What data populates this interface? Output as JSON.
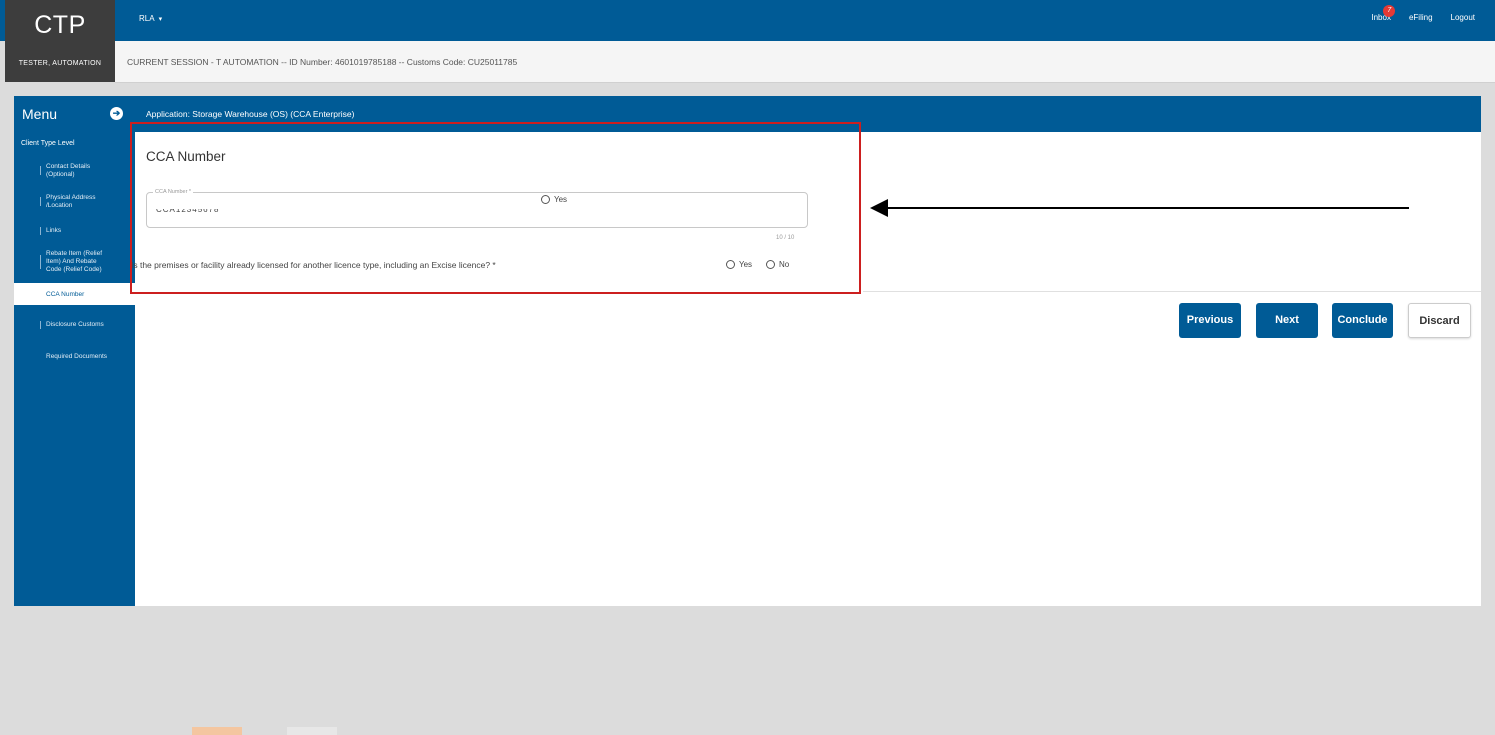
{
  "app": {
    "logo": "CTP",
    "user": "TESTER, AUTOMATION",
    "language": "RLA",
    "top_links": {
      "inbox": "Inbox",
      "inbox_count": "7",
      "efiling": "eFiling",
      "logout": "Logout"
    }
  },
  "session": {
    "text": "CURRENT SESSION - T AUTOMATION -- ID Number: 4601019785188 -- Customs Code: CU25011785"
  },
  "sidebar": {
    "title": "Menu",
    "section": "Client Type Level",
    "items": [
      {
        "label_lines": [
          "Contact Details",
          "(Optional)"
        ]
      },
      {
        "label_lines": [
          "Physical Address",
          "/Location"
        ]
      },
      {
        "label_lines": [
          "Links"
        ]
      },
      {
        "label_lines": [
          "Rebate Item (Relief",
          "Item) And Rebate",
          "Code (Relief Code)"
        ]
      },
      {
        "label_lines": [
          "CCA Number"
        ]
      },
      {
        "label_lines": [
          "Disclosure Customs"
        ]
      },
      {
        "label_lines": [
          "Required Documents"
        ]
      }
    ]
  },
  "main": {
    "header": "Application: Storage Warehouse (OS) (CCA Enterprise)",
    "section_title": "CCA Number",
    "field": {
      "label": "CCA Number *",
      "value": "CCA12345678",
      "radio_label": "Yes",
      "counter": "10 / 10"
    },
    "question": {
      "text": "Is the premises or facility already licensed for another licence type, including an Excise licence? *",
      "options": [
        "Yes",
        "No"
      ]
    },
    "buttons": {
      "previous": "Previous",
      "next": "Next",
      "conclude": "Conclude",
      "discard": "Discard"
    }
  },
  "colors": {
    "primary": "#005b96",
    "logo_bg": "#3d3d3d",
    "highlight": "#cc1f1f",
    "badge": "#e53935"
  },
  "annotations": [
    "red-highlight-box",
    "black-left-arrow"
  ]
}
